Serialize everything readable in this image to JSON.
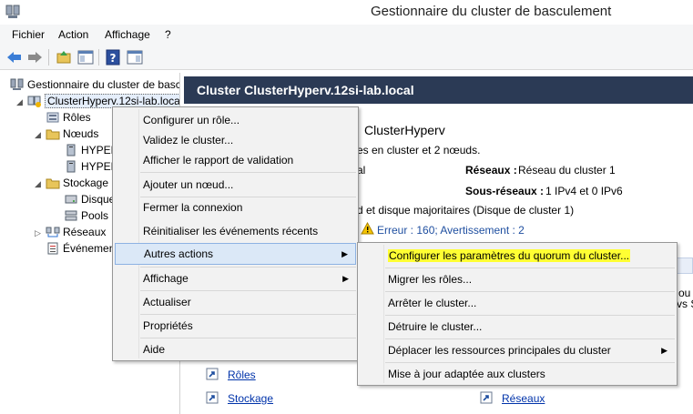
{
  "window": {
    "title": "Gestionnaire du cluster de basculement"
  },
  "menubar": {
    "items": [
      "Fichier",
      "Action",
      "Affichage",
      "?"
    ]
  },
  "tree": {
    "root": "Gestionnaire du cluster de basc",
    "cluster": "ClusterHyperv.12si-lab.local",
    "roles": "Rôles",
    "nodes": "Nœuds",
    "node1": "HYPER",
    "node2": "HYPER",
    "storage": "Stockage",
    "disks": "Disque",
    "pools": "Pools",
    "networks": "Réseaux",
    "events": "Événemen"
  },
  "right": {
    "header": "Cluster ClusterHyperv.12si-lab.local",
    "summary_title": "ClusterHyperv",
    "summary_line": "es en cluster et 2 nœuds.",
    "partial_al": "al",
    "networks_label": "Réseaux :",
    "networks_value": "Réseau du cluster 1",
    "subnets_label": "Sous-réseaux :",
    "subnets_value": "1 IPv4 et 0 IPv6",
    "quorum_line": "d et disque majoritaires (Disque de cluster 1)",
    "errors_line": "Erreur : 160; Avertissement : 2",
    "edge_ou": "ou",
    "edge_vs": "vs S",
    "link_roles": "Rôles",
    "link_storage": "Stockage",
    "link_networks": "Réseaux"
  },
  "context_menu": {
    "items": [
      "Configurer un rôle...",
      "Validez le cluster...",
      "Afficher le rapport de validation",
      "Ajouter un nœud...",
      "Fermer la connexion",
      "Réinitialiser les événements récents",
      "Autres actions",
      "Affichage",
      "Actualiser",
      "Propriétés",
      "Aide"
    ]
  },
  "submenu": {
    "items": [
      "Configurer les paramètres du quorum du cluster...",
      "Migrer les rôles...",
      "Arrêter le cluster...",
      "Détruire le cluster...",
      "Déplacer les ressources principales du cluster",
      "Mise à jour adaptée aux clusters"
    ]
  },
  "colors": {
    "header_bg": "#2b3a55",
    "highlight_bg": "#dbe8f7",
    "marker": "#ffff33",
    "link": "#0033aa",
    "warning": "#f5c400"
  }
}
